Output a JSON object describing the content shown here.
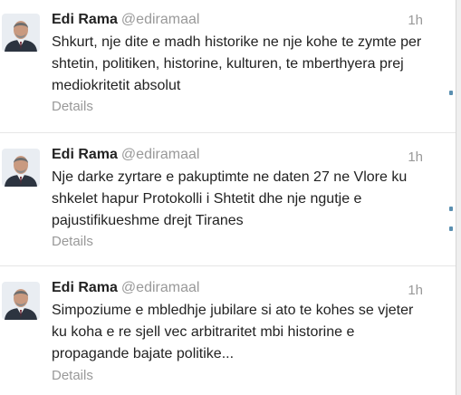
{
  "tweets": [
    {
      "name": "Edi Rama",
      "handle": "@ediramaal",
      "time": "1h",
      "text": "Shkurt, nje dite e madh historike ne nje kohe te zymte per shtetin, politiken, historine, kulturen, te mberthyera prej mediokritetit absolut",
      "details": "Details"
    },
    {
      "name": "Edi Rama",
      "handle": "@ediramaal",
      "time": "1h",
      "text": "Nje darke zyrtare e pakuptimte ne daten 27 ne Vlore ku shkelet hapur Protokolli i Shtetit dhe nje ngutje e pajustifikueshme drejt Tiranes",
      "details": "Details"
    },
    {
      "name": "Edi Rama",
      "handle": "@ediramaal",
      "time": "1h",
      "text": "Simpoziume e mbledhje jubilare si ato te kohes se vjeter ku koha e re sjell vec arbitraritet mbi historine e propagande bajate politike...",
      "details": "Details"
    }
  ],
  "colors": {
    "name": "#222222",
    "meta": "#999999",
    "divider": "#e6e6e6"
  },
  "icons": {
    "avatar": "profile-photo",
    "edge_marker": "blue-mark"
  }
}
